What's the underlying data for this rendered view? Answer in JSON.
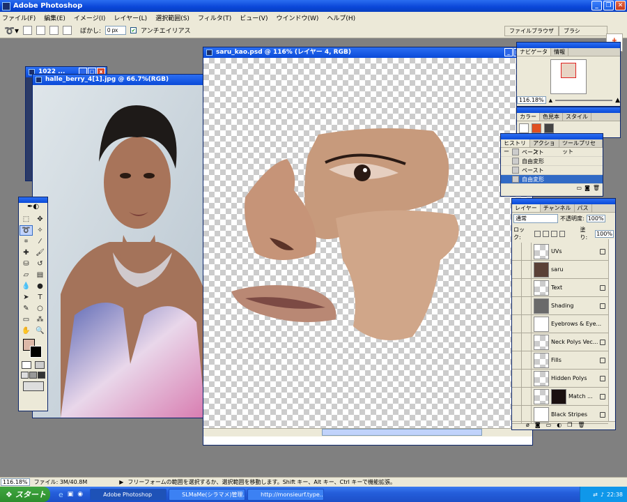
{
  "app": {
    "title": "Adobe Photoshop"
  },
  "menu": [
    "ファイル(F)",
    "編集(E)",
    "イメージ(I)",
    "レイヤー(L)",
    "選択範囲(S)",
    "フィルタ(T)",
    "ビュー(V)",
    "ウインドウ(W)",
    "ヘルプ(H)"
  ],
  "options": {
    "feather_label": "ぼかし:",
    "feather_value": "0 px",
    "antialias_label": "アンチエイリアス"
  },
  "palette_well": [
    "ファイルブラウザ",
    "ブラシ"
  ],
  "docs": {
    "back": {
      "title": "1022 ..."
    },
    "photo": {
      "title": "halle_berry_4[1].jpg @ 66.7%(RGB)"
    },
    "main": {
      "title": "saru_kao.psd @ 116% (レイヤー 4, RGB)"
    }
  },
  "navigator": {
    "tabs": [
      "ナビゲータ",
      "情報"
    ],
    "zoom": "116.18%"
  },
  "color": {
    "tabs": [
      "カラー",
      "色見本",
      "スタイル"
    ]
  },
  "history": {
    "tabs": [
      "ヒストリー",
      "アクション",
      "ツールプリセット"
    ],
    "items": [
      {
        "label": "ペースト",
        "selected": false
      },
      {
        "label": "自由変形",
        "selected": false
      },
      {
        "label": "ペースト",
        "selected": false
      },
      {
        "label": "自由変形",
        "selected": true
      }
    ]
  },
  "layers": {
    "tabs": [
      "レイヤー",
      "チャンネル",
      "パス"
    ],
    "blend": "通常",
    "opacity_label": "不透明度:",
    "opacity": "100%",
    "lock_label": "ロック:",
    "fill_label": "塗り:",
    "fill": "100%",
    "items": [
      "UVs",
      "saru",
      "Text",
      "Shading",
      "Eyebrows & Eye...",
      "Neck Polys Vec...",
      "Fills",
      "Hidden Polys",
      "Match ...",
      "Black Stripes"
    ]
  },
  "status": {
    "zoom": "116.18%",
    "file": "ファイル: 3M/40.8M",
    "hint": "フリーフォームの範囲を選択するか、選択範囲を移動します。Shift キー、Alt キー、Ctrl キーで機能拡張。"
  },
  "taskbar": {
    "start": "スタート",
    "tasks": [
      "Adobe Photoshop",
      "SLMaMe(シラマメ)管理...",
      "http://monsieurf.type..."
    ],
    "clock": "22:38"
  }
}
